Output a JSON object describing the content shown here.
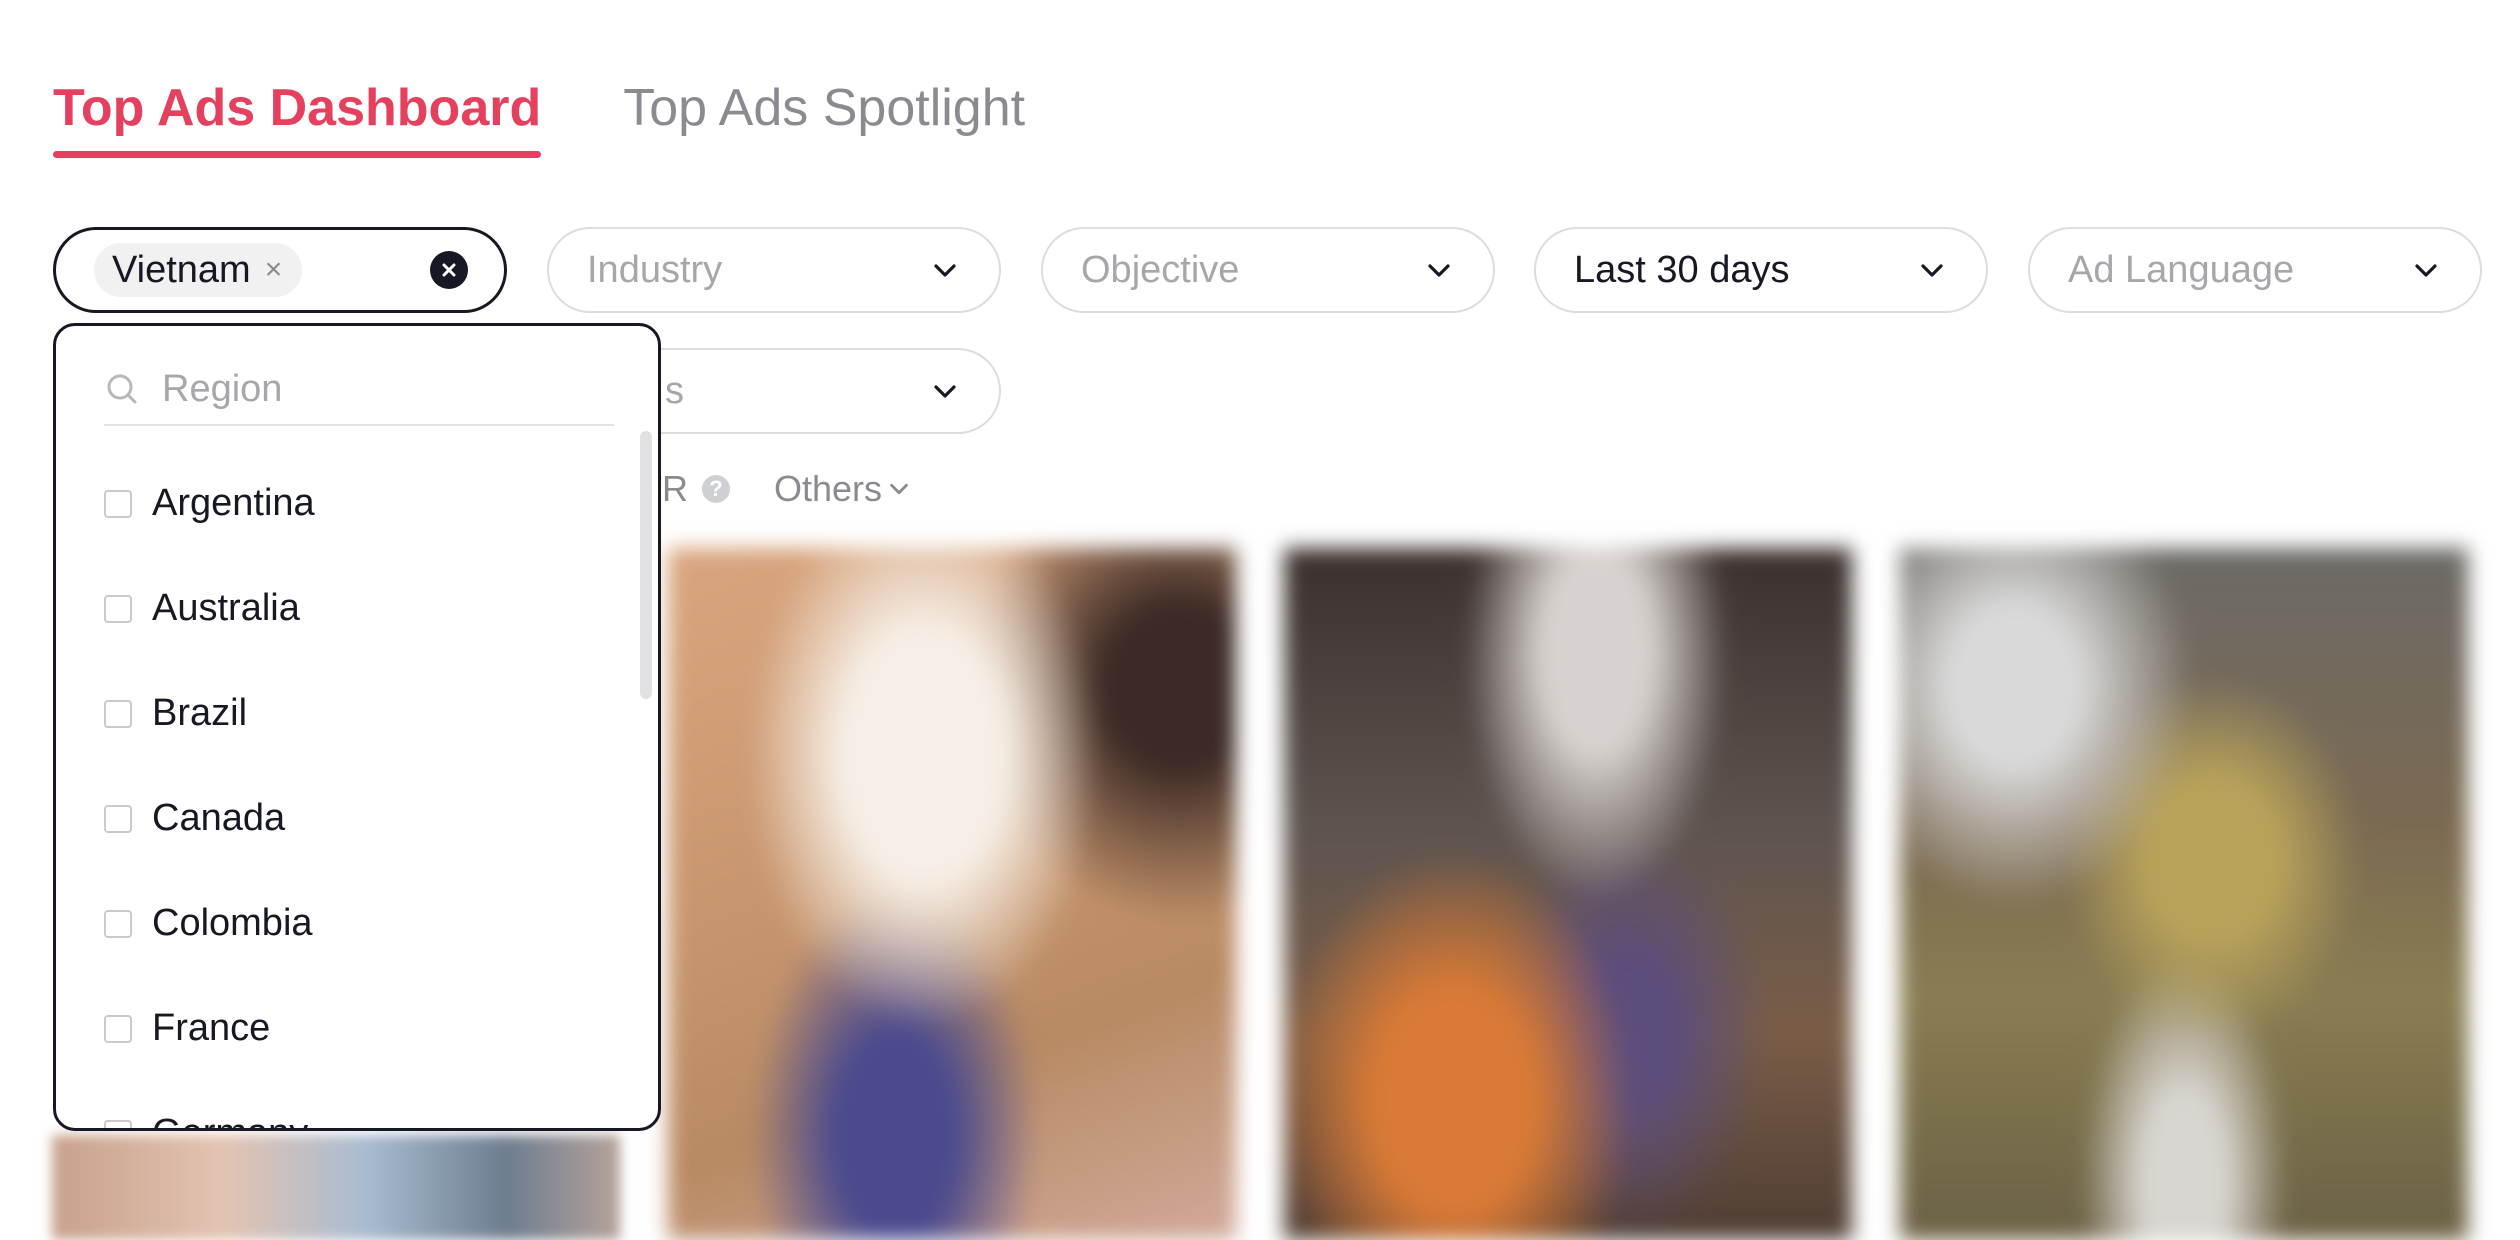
{
  "tabs": [
    {
      "label": "Top Ads Dashboard",
      "active": true
    },
    {
      "label": "Top Ads Spotlight",
      "active": false
    }
  ],
  "filters": {
    "region": {
      "chip": "Vietnam",
      "chip_remove": "×"
    },
    "industry": {
      "placeholder": "Industry"
    },
    "objective": {
      "placeholder": "Objective"
    },
    "date_range": {
      "value": "Last 30 days"
    },
    "ad_language": {
      "placeholder": "Ad Language"
    },
    "second_row_partial": {
      "placeholder": "s"
    }
  },
  "sort_bar": {
    "ctr_label_partial": "TR",
    "help_icon": "?",
    "others_label": "Others"
  },
  "region_dropdown": {
    "search_placeholder": "Region",
    "options": [
      "Argentina",
      "Australia",
      "Brazil",
      "Canada",
      "Colombia",
      "France",
      "Germany"
    ]
  },
  "colors": {
    "accent": "#e5405e",
    "text": "#161823",
    "muted": "#a6a7ab",
    "border": "#dcdcde"
  }
}
